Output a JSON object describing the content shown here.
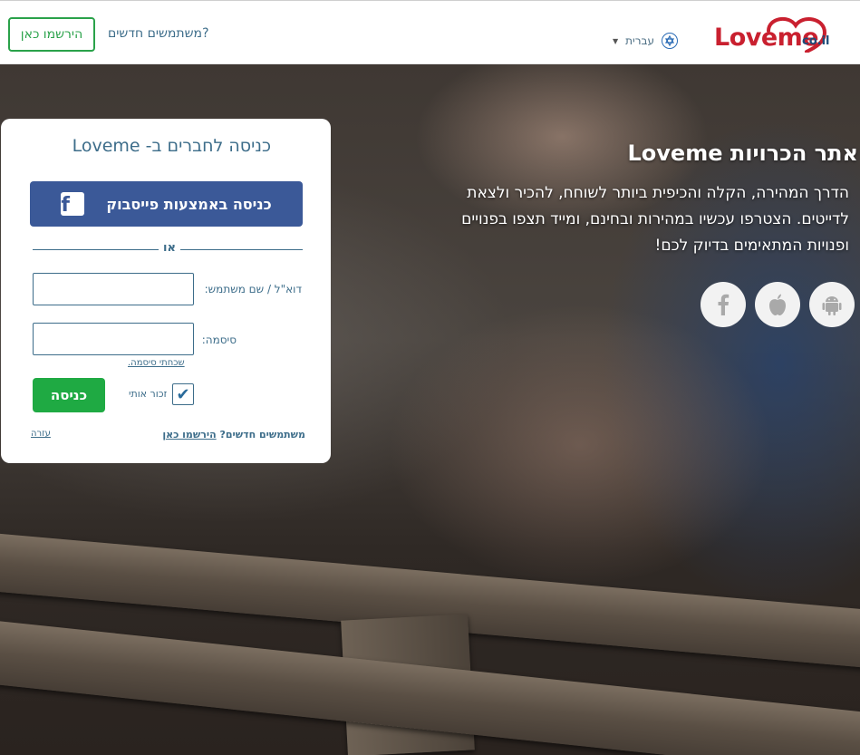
{
  "header": {
    "register_button": "הירשמו כאן",
    "new_users": "משתמשים חדשים?",
    "language": "עברית",
    "logo_main": "Loveme",
    "logo_suffix": "co.il"
  },
  "login": {
    "title": "כניסה לחברים ב- Loveme",
    "facebook_button": "כניסה באמצעות פייסבוק",
    "or": "או",
    "username_label": "דוא\"ל / שם משתמש:",
    "password_label": "סיסמה:",
    "forgot_password": "שכחתי סיסמה.",
    "remember_me": "זכור אותי",
    "remember_checked": true,
    "login_button": "כניסה",
    "bottom_new_users": "משתמשים חדשים?",
    "bottom_register": "הירשמו כאן",
    "help": "עזרה"
  },
  "hero": {
    "title": "אתר הכרויות Loveme",
    "description": "הדרך המהירה, הקלה והכיפית ביותר לשוחח, להכיר ולצאת לדייטים. הצטרפו עכשיו במהירות ובחינם, ומייד תצפו בפנויים ופנויות המתאימים בדיוק לכם!"
  },
  "apps": [
    "android-icon",
    "apple-icon",
    "facebook-icon"
  ],
  "colors": {
    "brand_red": "#c9202f",
    "brand_blue": "#3d6d8a",
    "green": "#1faa43",
    "facebook": "#3b5998"
  }
}
